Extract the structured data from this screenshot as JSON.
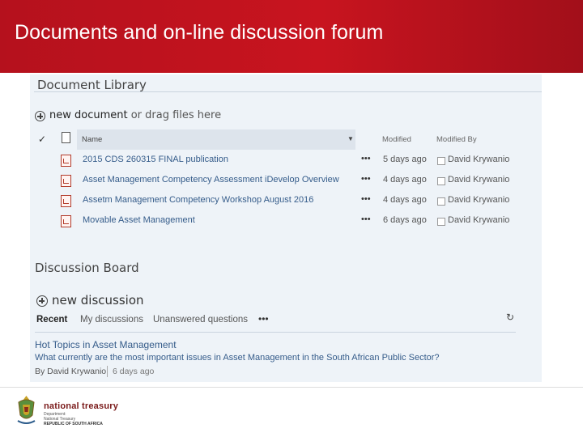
{
  "banner": {
    "title": "Documents and on-line discussion forum"
  },
  "library": {
    "title": "Document Library",
    "new_document_prefix": "new document",
    "new_document_suffix": " or drag files here",
    "columns": {
      "name": "Name",
      "modified": "Modified",
      "modified_by": "Modified By"
    },
    "rows": [
      {
        "name": "2015 CDS 260315 FINAL publication",
        "modified": "5 days ago",
        "modified_by": "David Krywanio"
      },
      {
        "name": "Asset Management Competency Assessment iDevelop Overview",
        "modified": "4 days ago",
        "modified_by": "David Krywanio"
      },
      {
        "name": "Assetm Management Competency Workshop August 2016",
        "modified": "4 days ago",
        "modified_by": "David Krywanio"
      },
      {
        "name": "Movable Asset Management",
        "modified": "6 days ago",
        "modified_by": "David Krywanio"
      }
    ],
    "row_menu": "•••"
  },
  "discussion": {
    "title": "Discussion Board",
    "new_label": "new discussion",
    "tabs": [
      "Recent",
      "My discussions",
      "Unanswered questions"
    ],
    "tabs_more": "•••",
    "topic": {
      "title": "Hot Topics in Asset Management",
      "body": "What currently are the most important issues in Asset Management in the South African Public Sector?",
      "by": "By David Krywanio",
      "ago": "6 days ago"
    }
  },
  "footer": {
    "logo_name": "national treasury",
    "logo_line1": "Department:",
    "logo_line2": "National Treasury",
    "logo_line3": "REPUBLIC OF SOUTH AFRICA"
  },
  "colors": {
    "banner": "#c8141f",
    "panel": "#eef3f8",
    "link": "#355c8a"
  }
}
